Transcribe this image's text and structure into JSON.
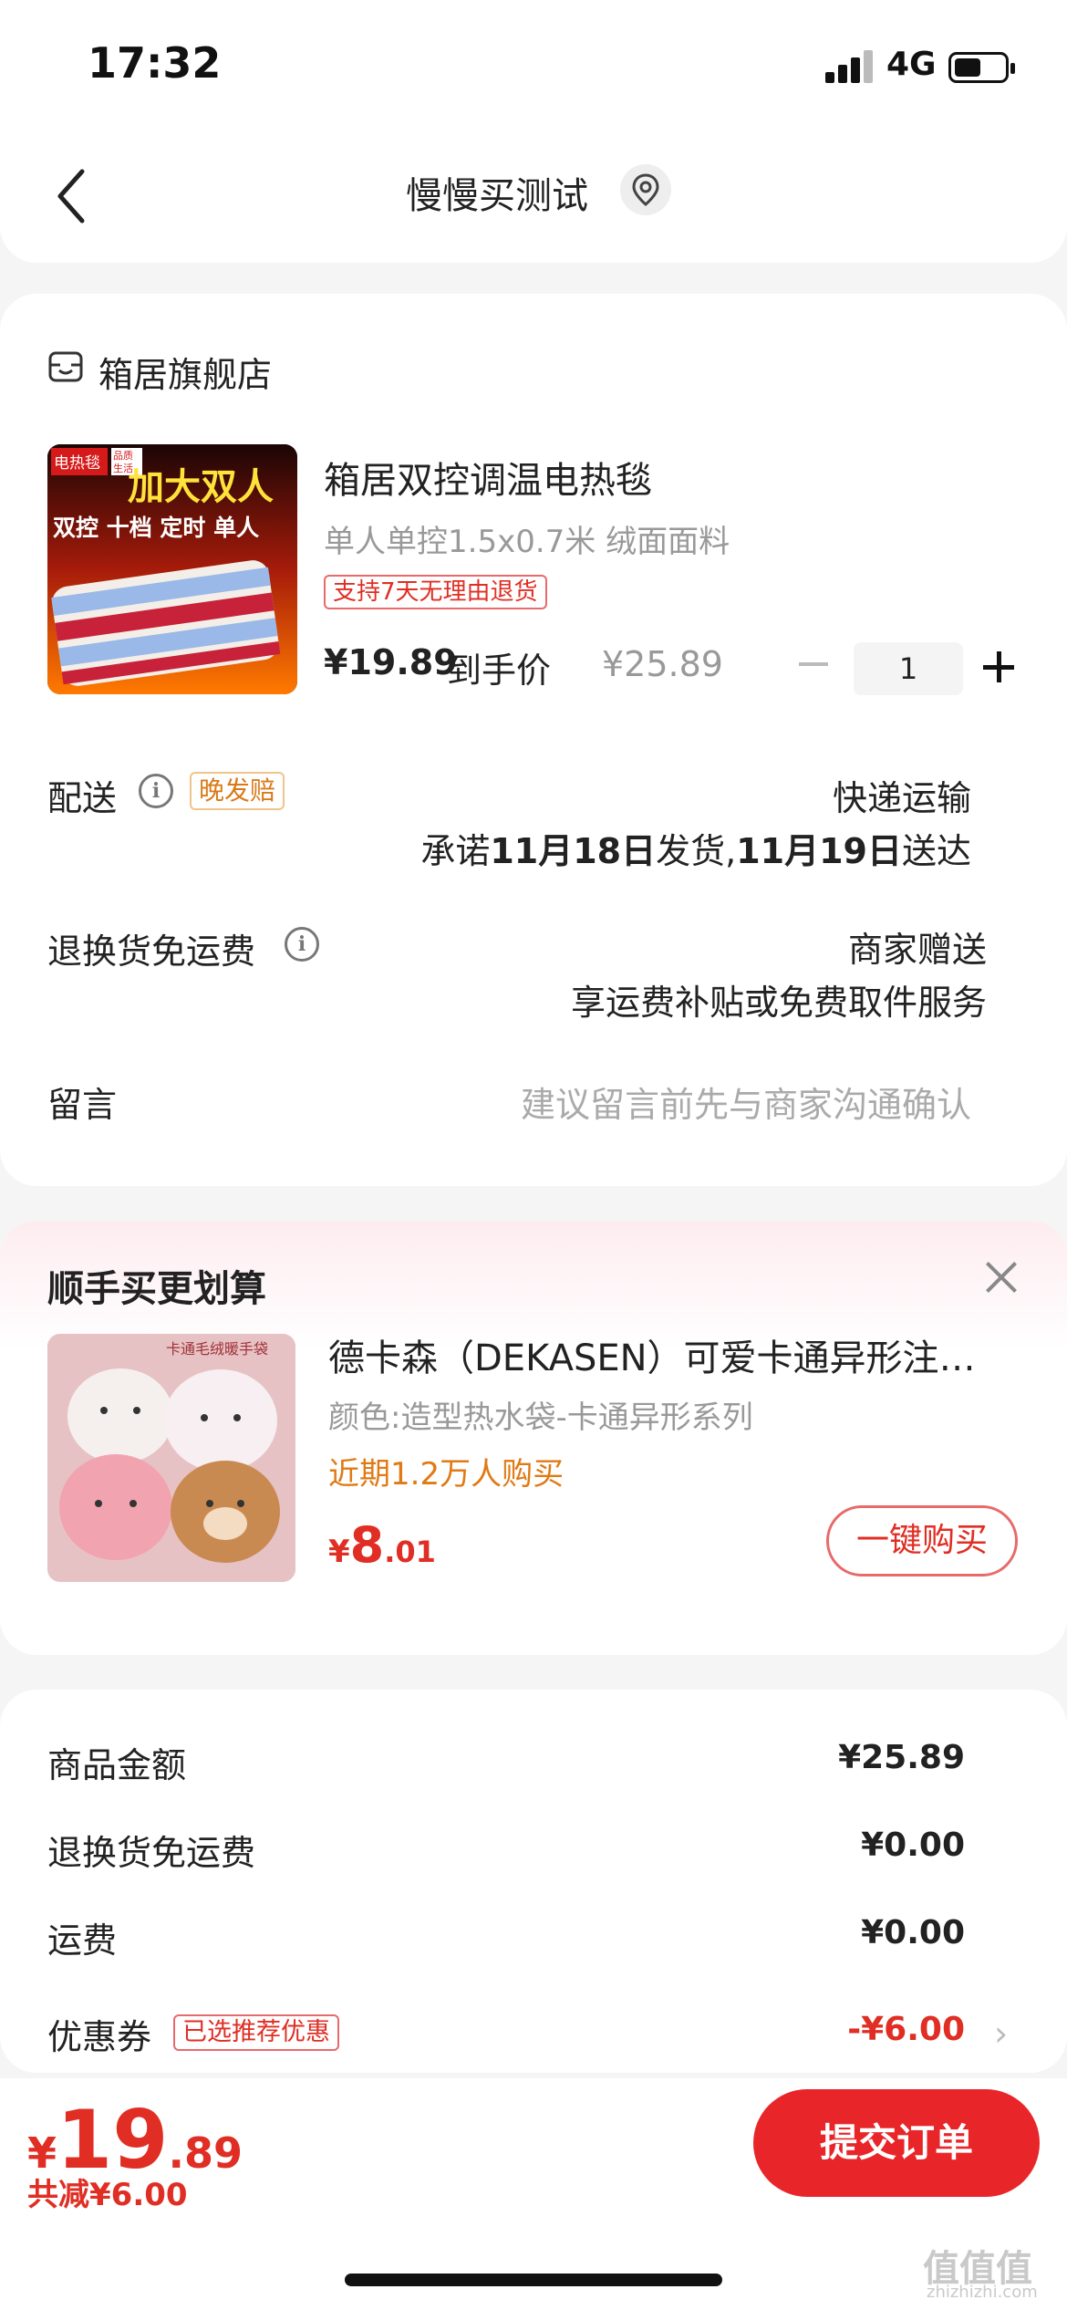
{
  "status_bar": {
    "time": "17:32",
    "network": "4G"
  },
  "nav": {
    "title": "慢慢买测试"
  },
  "order": {
    "store_name": "箱居旗舰店",
    "product": {
      "title": "箱居双控调温电热毯",
      "spec": "单人单控1.5x0.7米 绒面面料",
      "return_badge": "支持7天无理由退货",
      "final_price": "¥19.89",
      "final_price_label": "到手价",
      "original_price": "¥25.89",
      "quantity": "1",
      "image_text_big": "加大双人",
      "image_text_line": "双控 十档 定时 单人",
      "image_text_tag": "电热毯",
      "image_text_tag2": "品质生活"
    },
    "delivery": {
      "label": "配送",
      "badge": "晚发赔",
      "method": "快递运输",
      "promise_prefix": "承诺",
      "ship_date": "11月18日",
      "ship_suffix": "发货,",
      "arrive_date": "11月19日",
      "arrive_suffix": "送达"
    },
    "return_shipping": {
      "label": "退换货免运费",
      "value": "商家赠送",
      "desc": "享运费补贴或免费取件服务"
    },
    "message": {
      "label": "留言",
      "placeholder": "建议留言前先与商家沟通确认"
    }
  },
  "recommend": {
    "title": "顺手买更划算",
    "item": {
      "name": "德卡森（DEKASEN）可爱卡通异形注水热水袋",
      "spec": "颜色:造型热水袋-卡通异形系列",
      "sales": "近期1.2万人购买",
      "price_currency": "¥",
      "price_int": "8",
      "price_dec": ".01",
      "buy_label": "一键购买",
      "image_text": "卡通毛绒暖手袋"
    }
  },
  "summary": {
    "rows": [
      {
        "label": "商品金额",
        "value": "¥25.89"
      },
      {
        "label": "退换货免运费",
        "value": "¥0.00"
      },
      {
        "label": "运费",
        "value": "¥0.00"
      },
      {
        "label": "优惠券",
        "value": "-¥6.00",
        "badge": "已选推荐优惠"
      }
    ]
  },
  "bottom": {
    "currency": "¥",
    "total_int": "19",
    "total_dec": ".89",
    "saved": "共减¥6.00",
    "submit_label": "提交订单"
  },
  "watermark": {
    "text": "值值值",
    "sub": "zhizhizhi.com"
  }
}
